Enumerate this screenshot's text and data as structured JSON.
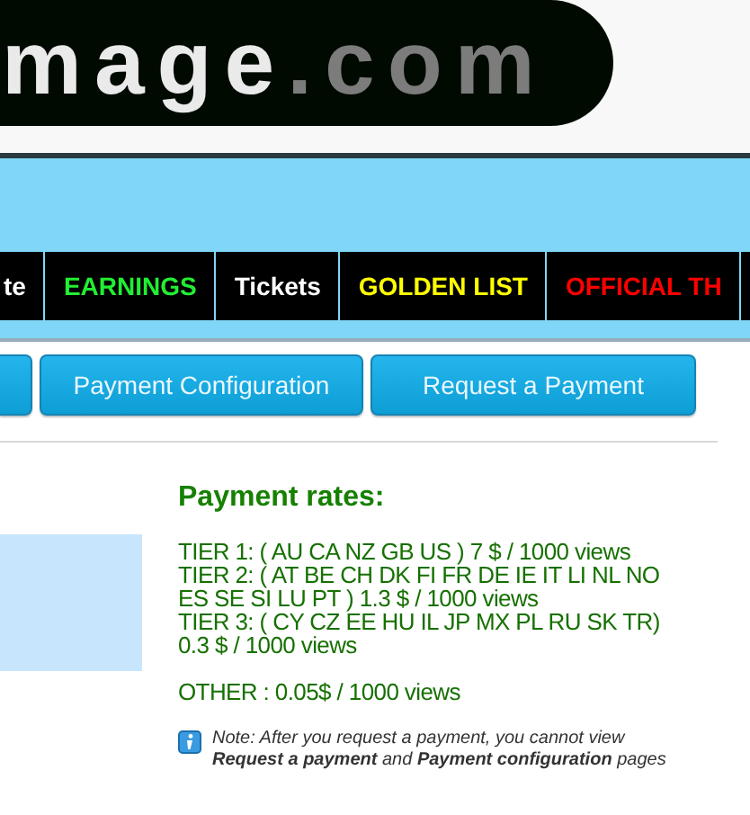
{
  "logo": {
    "main": "mage",
    "suffix": ".com"
  },
  "nav": [
    {
      "label": "te",
      "color": "#ffffff"
    },
    {
      "label": "EARNINGS",
      "color": "#22ee33"
    },
    {
      "label": "Tickets",
      "color": "#ffffff"
    },
    {
      "label": "GOLDEN LIST",
      "color": "#ffff00"
    },
    {
      "label": "OFFICIAL TH",
      "color": "#ff0000"
    }
  ],
  "buttons": [
    "Payment Configuration",
    "Request a Payment"
  ],
  "rates": {
    "title": "Payment rates:",
    "tiers": [
      "TIER 1: ( AU CA NZ GB US ) 7 $ / 1000 views",
      "TIER 2: ( AT BE CH DK FI FR DE IE IT LI NL NO ES SE SI LU PT ) 1.3 $ / 1000 views",
      "TIER 3: ( CY CZ EE HU IL JP MX PL RU SK TR) 0.3 $ / 1000 views"
    ],
    "other": "OTHER : 0.05$ / 1000 views",
    "note": "Note: After you request a payment, you cannot view **Request a payment** and **Payment configuration** pages"
  }
}
